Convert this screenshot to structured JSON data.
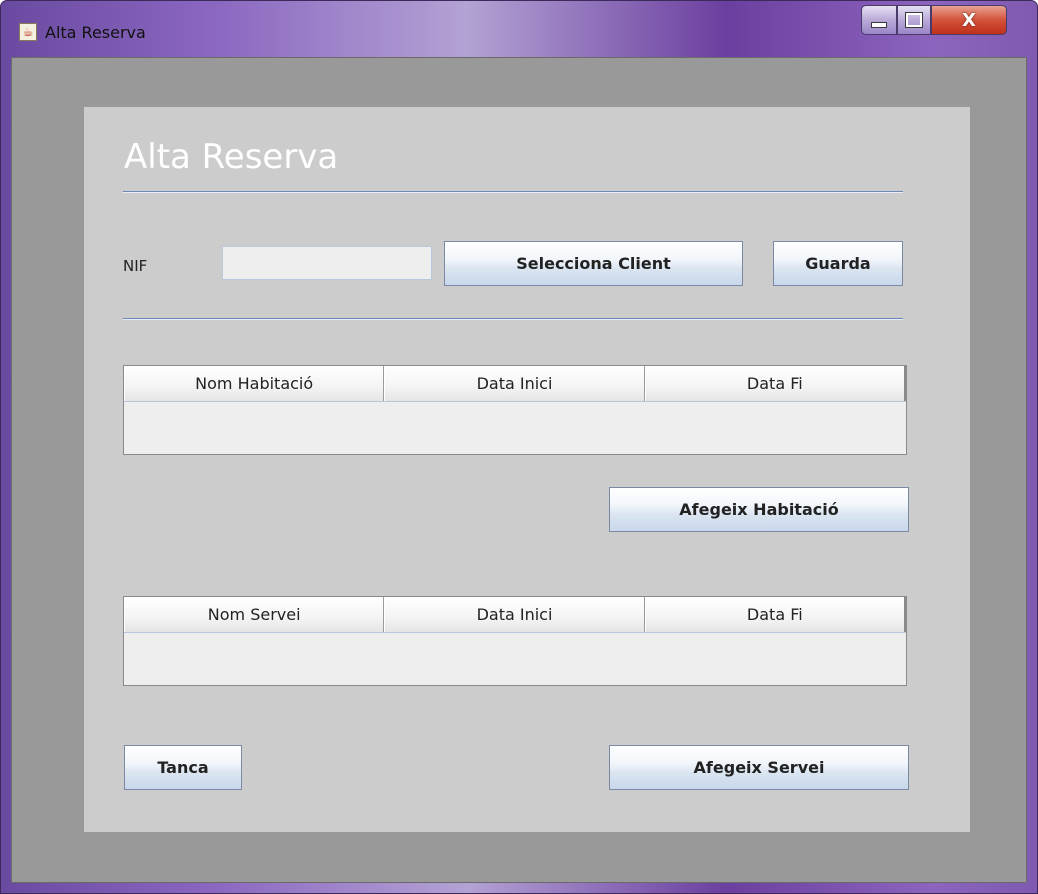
{
  "window": {
    "title": "Alta Reserva",
    "app_icon": "java-cup-icon",
    "controls": {
      "minimize_icon": "minimize-icon",
      "maximize_icon": "maximize-icon",
      "close_label": "X"
    }
  },
  "form": {
    "heading": "Alta Reserva",
    "nif_label": "NIF",
    "nif_value": "",
    "select_client_button": "Selecciona Client",
    "save_button": "Guarda",
    "rooms_table": {
      "columns": [
        "Nom Habitació",
        "Data Inici",
        "Data Fi"
      ],
      "rows": []
    },
    "add_room_button": "Afegeix Habitació",
    "services_table": {
      "columns": [
        "Nom Servei",
        "Data Inici",
        "Data Fi"
      ],
      "rows": []
    },
    "close_button": "Tanca",
    "add_service_button": "Afegeix Servei"
  },
  "colors": {
    "panel_background": "#cccccc",
    "client_background": "#999999",
    "separator": "#6b86b8",
    "heading_text": "#ffffff"
  }
}
